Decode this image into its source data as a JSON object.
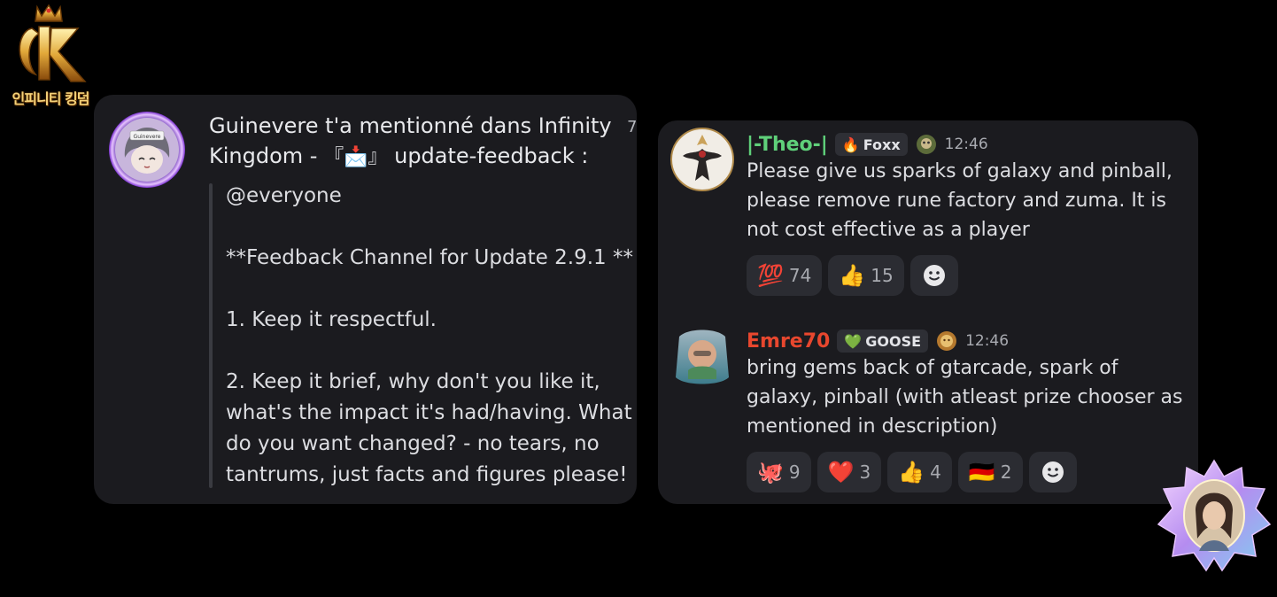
{
  "logo": {
    "text": "인피니티 킹덤",
    "letter": "IK"
  },
  "notification": {
    "title_before": "Guinevere t'a mentionné dans Infinity Kingdom - ",
    "title_emoji": "『📩』",
    "title_after": " update-feedback :",
    "time": "7",
    "avatar_label": "Guinevere",
    "quote": "@everyone\n\n**Feedback Channel for Update 2.9.1 **\n\n1. Keep it respectful.\n\n2. Keep it brief, why don't you like it, what's the impact it's had/having. What do you want changed? - no tears, no tantrums, just facts and figures please!"
  },
  "messages": [
    {
      "username": "|-Theo-|",
      "username_color": "#5fd07a",
      "tag": {
        "icon": "🔥",
        "label": "Foxx"
      },
      "time": "12:46",
      "text": "Please give us sparks of galaxy and pinball, please remove rune factory and zuma. It is not cost effective as a player",
      "reactions": [
        {
          "emoji": "💯",
          "count": "74"
        },
        {
          "emoji": "👍",
          "count": "15"
        }
      ]
    },
    {
      "username": "Emre70",
      "username_color": "#e8472e",
      "tag": {
        "icon": "💚",
        "label": "GOOSE"
      },
      "time": "12:46",
      "text": "bring gems back of gtarcade, spark of galaxy, pinball (with atleast prize chooser as mentioned in description)",
      "reactions": [
        {
          "emoji": "🐙",
          "count": "9"
        },
        {
          "emoji": "❤️",
          "count": "3"
        },
        {
          "emoji": "👍",
          "count": "4"
        },
        {
          "emoji": "🇩🇪",
          "count": "2"
        }
      ]
    }
  ],
  "add_reaction_icon": "☻"
}
